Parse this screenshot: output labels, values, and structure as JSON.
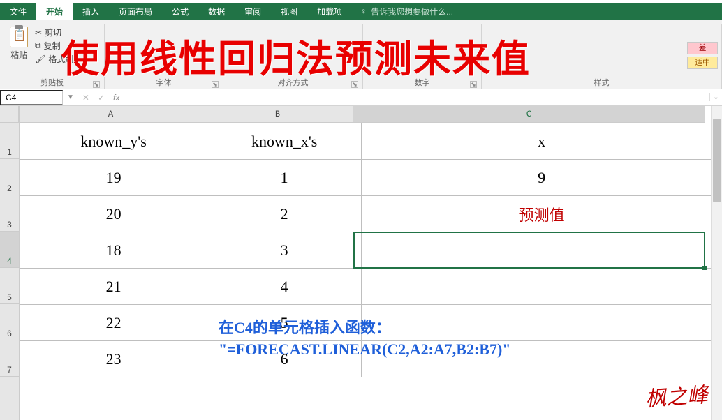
{
  "tabs": {
    "file": "文件",
    "home": "开始",
    "insert": "插入",
    "layout": "页面布局",
    "formulas": "公式",
    "data": "数据",
    "review": "审阅",
    "view": "视图",
    "addins": "加载项",
    "tellme": "告诉我您想要做什么..."
  },
  "ribbon": {
    "paste": "粘贴",
    "cut": "剪切",
    "copy": "复制",
    "fmtpaint": "格式刷",
    "grp_clipboard": "剪贴板",
    "grp_font": "字体",
    "grp_align": "对齐方式",
    "grp_number": "数字",
    "grp_styles": "样式",
    "cf_bad": "差",
    "cf_neutral": "适中"
  },
  "overlay_title": "使用线性回归法预测未来值",
  "namebox": "C4",
  "formula": "",
  "columns": {
    "A": "A",
    "B": "B",
    "C": "C"
  },
  "rows": [
    "1",
    "2",
    "3",
    "4",
    "5",
    "6",
    "7"
  ],
  "sheet": {
    "A1": "known_y's",
    "B1": "known_x's",
    "C1": "x",
    "A2": "19",
    "B2": "1",
    "C2": "9",
    "A3": "20",
    "B3": "2",
    "C3": "预测值",
    "A4": "18",
    "B4": "3",
    "C4": "",
    "A5": "21",
    "B5": "4",
    "C5": "",
    "A6": "22",
    "B6": "5",
    "C6": "",
    "A7": "23",
    "B7": "6",
    "C7": ""
  },
  "col_widths": {
    "A": 262,
    "B": 216,
    "C": 504
  },
  "annotation_line1": "在C4的单元格插入函数：",
  "annotation_line2": "\"=FORECAST.LINEAR(C2,A2:A7,B2:B7)\"",
  "signature": "枫之峰",
  "chart_data": {
    "type": "table",
    "columns": [
      "known_y's",
      "known_x's",
      "x"
    ],
    "rows": [
      [
        19,
        1,
        9
      ],
      [
        20,
        2,
        "预测值"
      ],
      [
        18,
        3,
        null
      ],
      [
        21,
        4,
        null
      ],
      [
        22,
        5,
        null
      ],
      [
        23,
        6,
        null
      ]
    ],
    "note": "FORECAST.LINEAR(C2,A2:A7,B2:B7) — linear regression forecast at x=9"
  }
}
